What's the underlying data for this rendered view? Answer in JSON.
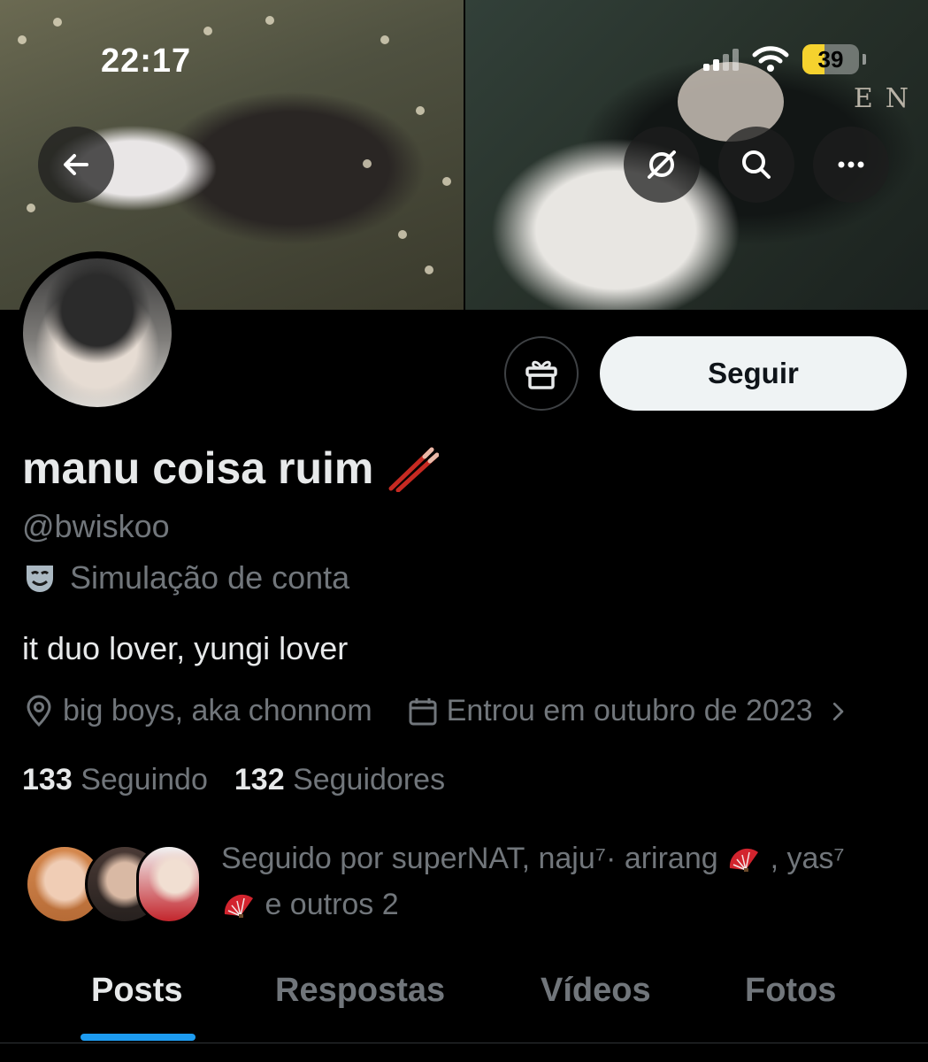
{
  "status_bar": {
    "time": "22:17",
    "battery": {
      "level_percent": 39,
      "label": "39",
      "color": "#f5d22e"
    }
  },
  "header": {
    "back_icon": "arrow-left-icon",
    "actions": [
      "grok-icon",
      "search-icon",
      "more-icon"
    ]
  },
  "banner": {
    "watermark_letters": "EN"
  },
  "profile": {
    "display_name": "manu coisa ruim",
    "name_emoji": "chopsticks-emoji",
    "handle": "@bwiskoo",
    "label_icon": "theater-mask-icon",
    "label_text": "Simulação de conta",
    "bio": "it duo lover, yungi lover",
    "location": "big boys, aka chonnom",
    "joined": "Entrou em outubro de 2023",
    "following_count": "133",
    "following_label": "Seguindo",
    "followers_count": "132",
    "followers_label": "Seguidores",
    "followed_by": {
      "prefix": "Seguido por superNAT, naju⁷· arirang",
      "mid": ", yas⁷",
      "suffix": "e outros 2"
    }
  },
  "buttons": {
    "gift_icon": "gift-icon",
    "follow_label": "Seguir"
  },
  "tabs": [
    {
      "label": "Posts",
      "active": true
    },
    {
      "label": "Respostas",
      "active": false
    },
    {
      "label": "Vídeos",
      "active": false
    },
    {
      "label": "Fotos",
      "active": false
    }
  ],
  "colors": {
    "accent": "#1d9bf0",
    "secondary_text": "#71767b",
    "primary_text": "#e7e9ea",
    "background": "#000000"
  }
}
